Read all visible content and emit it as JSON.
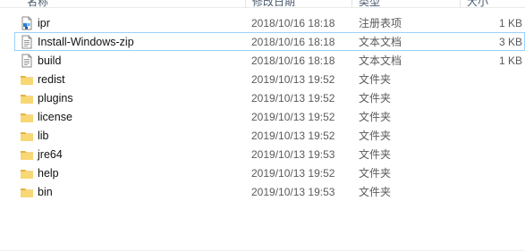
{
  "header": {
    "columns": [
      {
        "label": "名称"
      },
      {
        "label": "修改日期"
      },
      {
        "label": "类型"
      },
      {
        "label": "大小"
      }
    ]
  },
  "files": [
    {
      "name": "ipr",
      "date": "2018/10/16 18:18",
      "type": "注册表项",
      "size": "1 KB",
      "icon": "registry-file-icon",
      "selected": false
    },
    {
      "name": "Install-Windows-zip",
      "date": "2018/10/16 18:18",
      "type": "文本文档",
      "size": "3 KB",
      "icon": "text-file-icon",
      "selected": true
    },
    {
      "name": "build",
      "date": "2018/10/16 18:18",
      "type": "文本文档",
      "size": "1 KB",
      "icon": "text-file-icon",
      "selected": false
    },
    {
      "name": "redist",
      "date": "2019/10/13 19:52",
      "type": "文件夹",
      "size": "",
      "icon": "folder-icon",
      "selected": false
    },
    {
      "name": "plugins",
      "date": "2019/10/13 19:52",
      "type": "文件夹",
      "size": "",
      "icon": "folder-icon",
      "selected": false
    },
    {
      "name": "license",
      "date": "2019/10/13 19:52",
      "type": "文件夹",
      "size": "",
      "icon": "folder-icon",
      "selected": false
    },
    {
      "name": "lib",
      "date": "2019/10/13 19:52",
      "type": "文件夹",
      "size": "",
      "icon": "folder-icon",
      "selected": false
    },
    {
      "name": "jre64",
      "date": "2019/10/13 19:53",
      "type": "文件夹",
      "size": "",
      "icon": "folder-icon",
      "selected": false
    },
    {
      "name": "help",
      "date": "2019/10/13 19:52",
      "type": "文件夹",
      "size": "",
      "icon": "folder-icon",
      "selected": false
    },
    {
      "name": "bin",
      "date": "2019/10/13 19:53",
      "type": "文件夹",
      "size": "",
      "icon": "folder-icon",
      "selected": false
    }
  ],
  "colors": {
    "selection_border": "#99d1ff",
    "folder": "#f8d775",
    "folder_dark": "#e2b33f",
    "registry_accent": "#2a7fd4"
  }
}
